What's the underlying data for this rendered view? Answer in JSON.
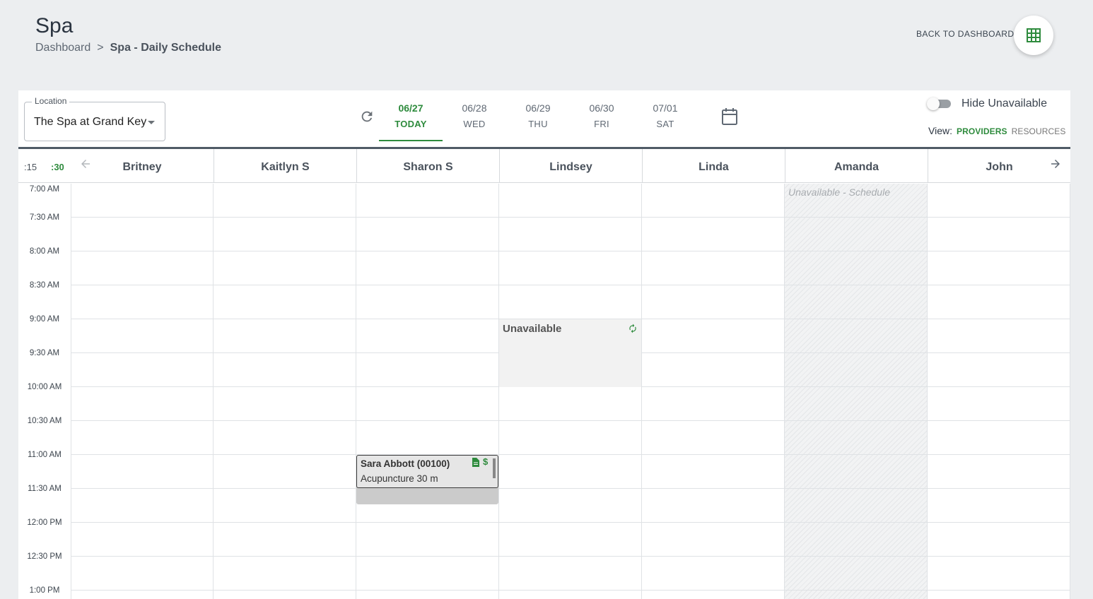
{
  "page": {
    "title": "Spa"
  },
  "breadcrumb": {
    "root": "Dashboard",
    "separator": ">",
    "current": "Spa - Daily Schedule"
  },
  "header_actions": {
    "back_label": "BACK TO DASHBOARD",
    "fab_icon": "grid-icon"
  },
  "location": {
    "label": "Location",
    "value": "The Spa at Grand Key"
  },
  "dates": [
    {
      "date": "06/27",
      "day": "TODAY",
      "active": true
    },
    {
      "date": "06/28",
      "day": "WED",
      "active": false
    },
    {
      "date": "06/29",
      "day": "THU",
      "active": false
    },
    {
      "date": "06/30",
      "day": "FRI",
      "active": false
    },
    {
      "date": "07/01",
      "day": "SAT",
      "active": false
    }
  ],
  "toggle": {
    "label": "Hide Unavailable",
    "on": false
  },
  "view": {
    "label": "View:",
    "providers": "PROVIDERS",
    "resources": "RESOURCES",
    "selected": "providers"
  },
  "intervals": {
    "opt15": ":15",
    "opt30": ":30",
    "selected": ":30"
  },
  "providers": [
    "Britney",
    "Kaitlyn S",
    "Sharon S",
    "Lindsey",
    "Linda",
    "Amanda",
    "John"
  ],
  "times": [
    "7:00 AM",
    "7:30 AM",
    "8:00 AM",
    "8:30 AM",
    "9:00 AM",
    "9:30 AM",
    "10:00 AM",
    "10:30 AM",
    "11:00 AM",
    "11:30 AM",
    "12:00 PM",
    "12:30 PM",
    "1:00 PM"
  ],
  "blocks": {
    "lindsey_unavailable": "Unavailable",
    "amanda_unavailable": "Unavailable - Schedule"
  },
  "appointment": {
    "provider": "Sharon S",
    "client": "Sara Abbott (00100)",
    "service": "Acupuncture 30 m",
    "pay_symbol": "$"
  },
  "colors": {
    "accent": "#2e8b3d",
    "header_bar": "#4f5b66",
    "background": "#eceef0"
  }
}
